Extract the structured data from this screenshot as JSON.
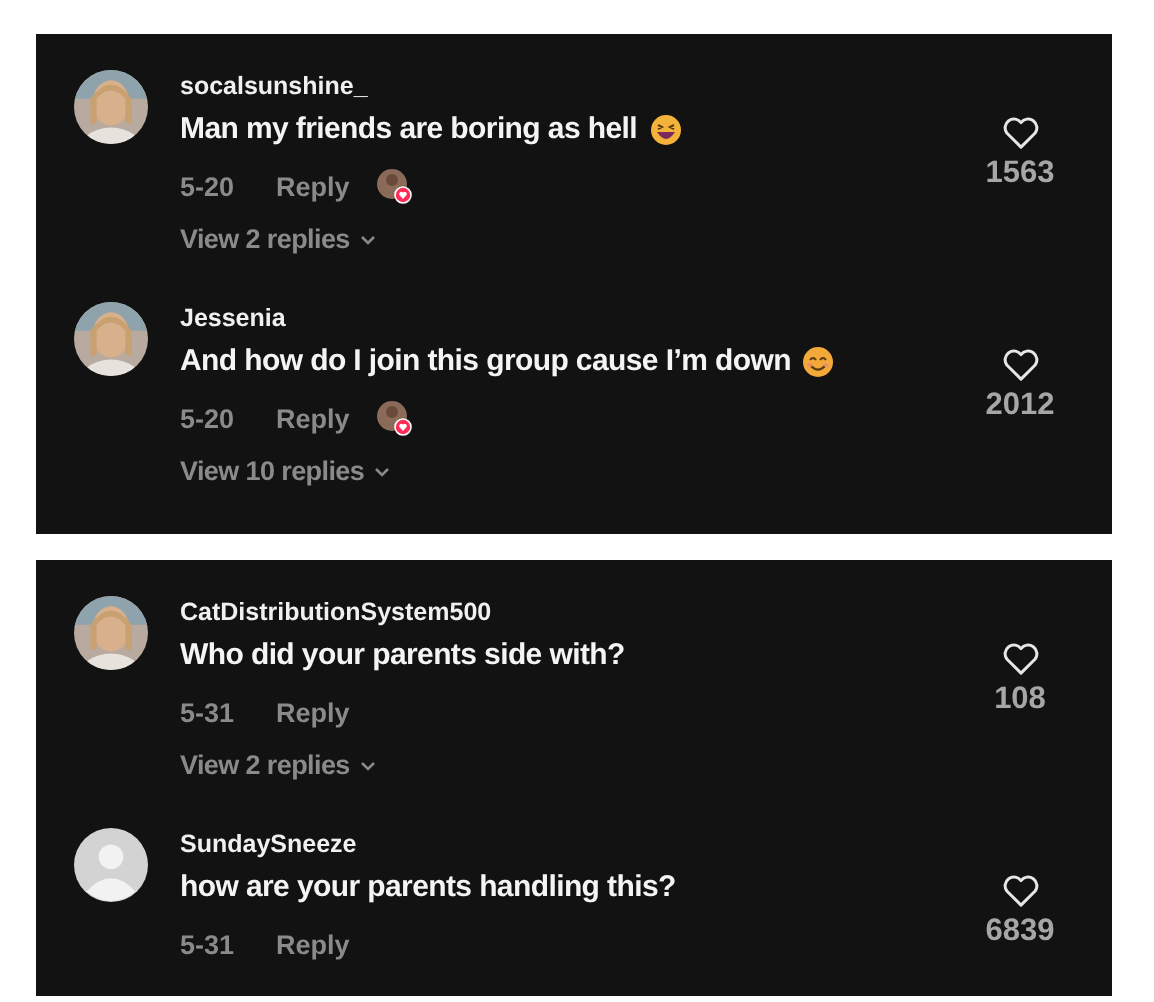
{
  "panels": [
    {
      "comments": [
        {
          "username": "socalsunshine_",
          "text": "Man my friends are boring as hell",
          "emoji": {
            "kind": "laugh"
          },
          "date": "5-20",
          "reply": "Reply",
          "creator_liked": true,
          "view_replies": "View 2 replies",
          "likes": "1563"
        },
        {
          "username": "Jessenia",
          "text": "And how do I join this group cause I’m down",
          "emoji": {
            "kind": "smile"
          },
          "date": "5-20",
          "reply": "Reply",
          "creator_liked": true,
          "view_replies": "View 10 replies",
          "likes": "2012"
        }
      ]
    },
    {
      "comments": [
        {
          "username": "CatDistributionSystem500",
          "text": "Who did your parents side with?",
          "date": "5-31",
          "reply": "Reply",
          "creator_liked": false,
          "view_replies": "View 2 replies",
          "likes": "108"
        },
        {
          "avatar": {
            "kind": "default"
          },
          "username": "SundaySneeze",
          "text": "how are your parents handling this?",
          "date": "5-31",
          "reply": "Reply",
          "creator_liked": false,
          "likes": "6839"
        }
      ]
    }
  ]
}
